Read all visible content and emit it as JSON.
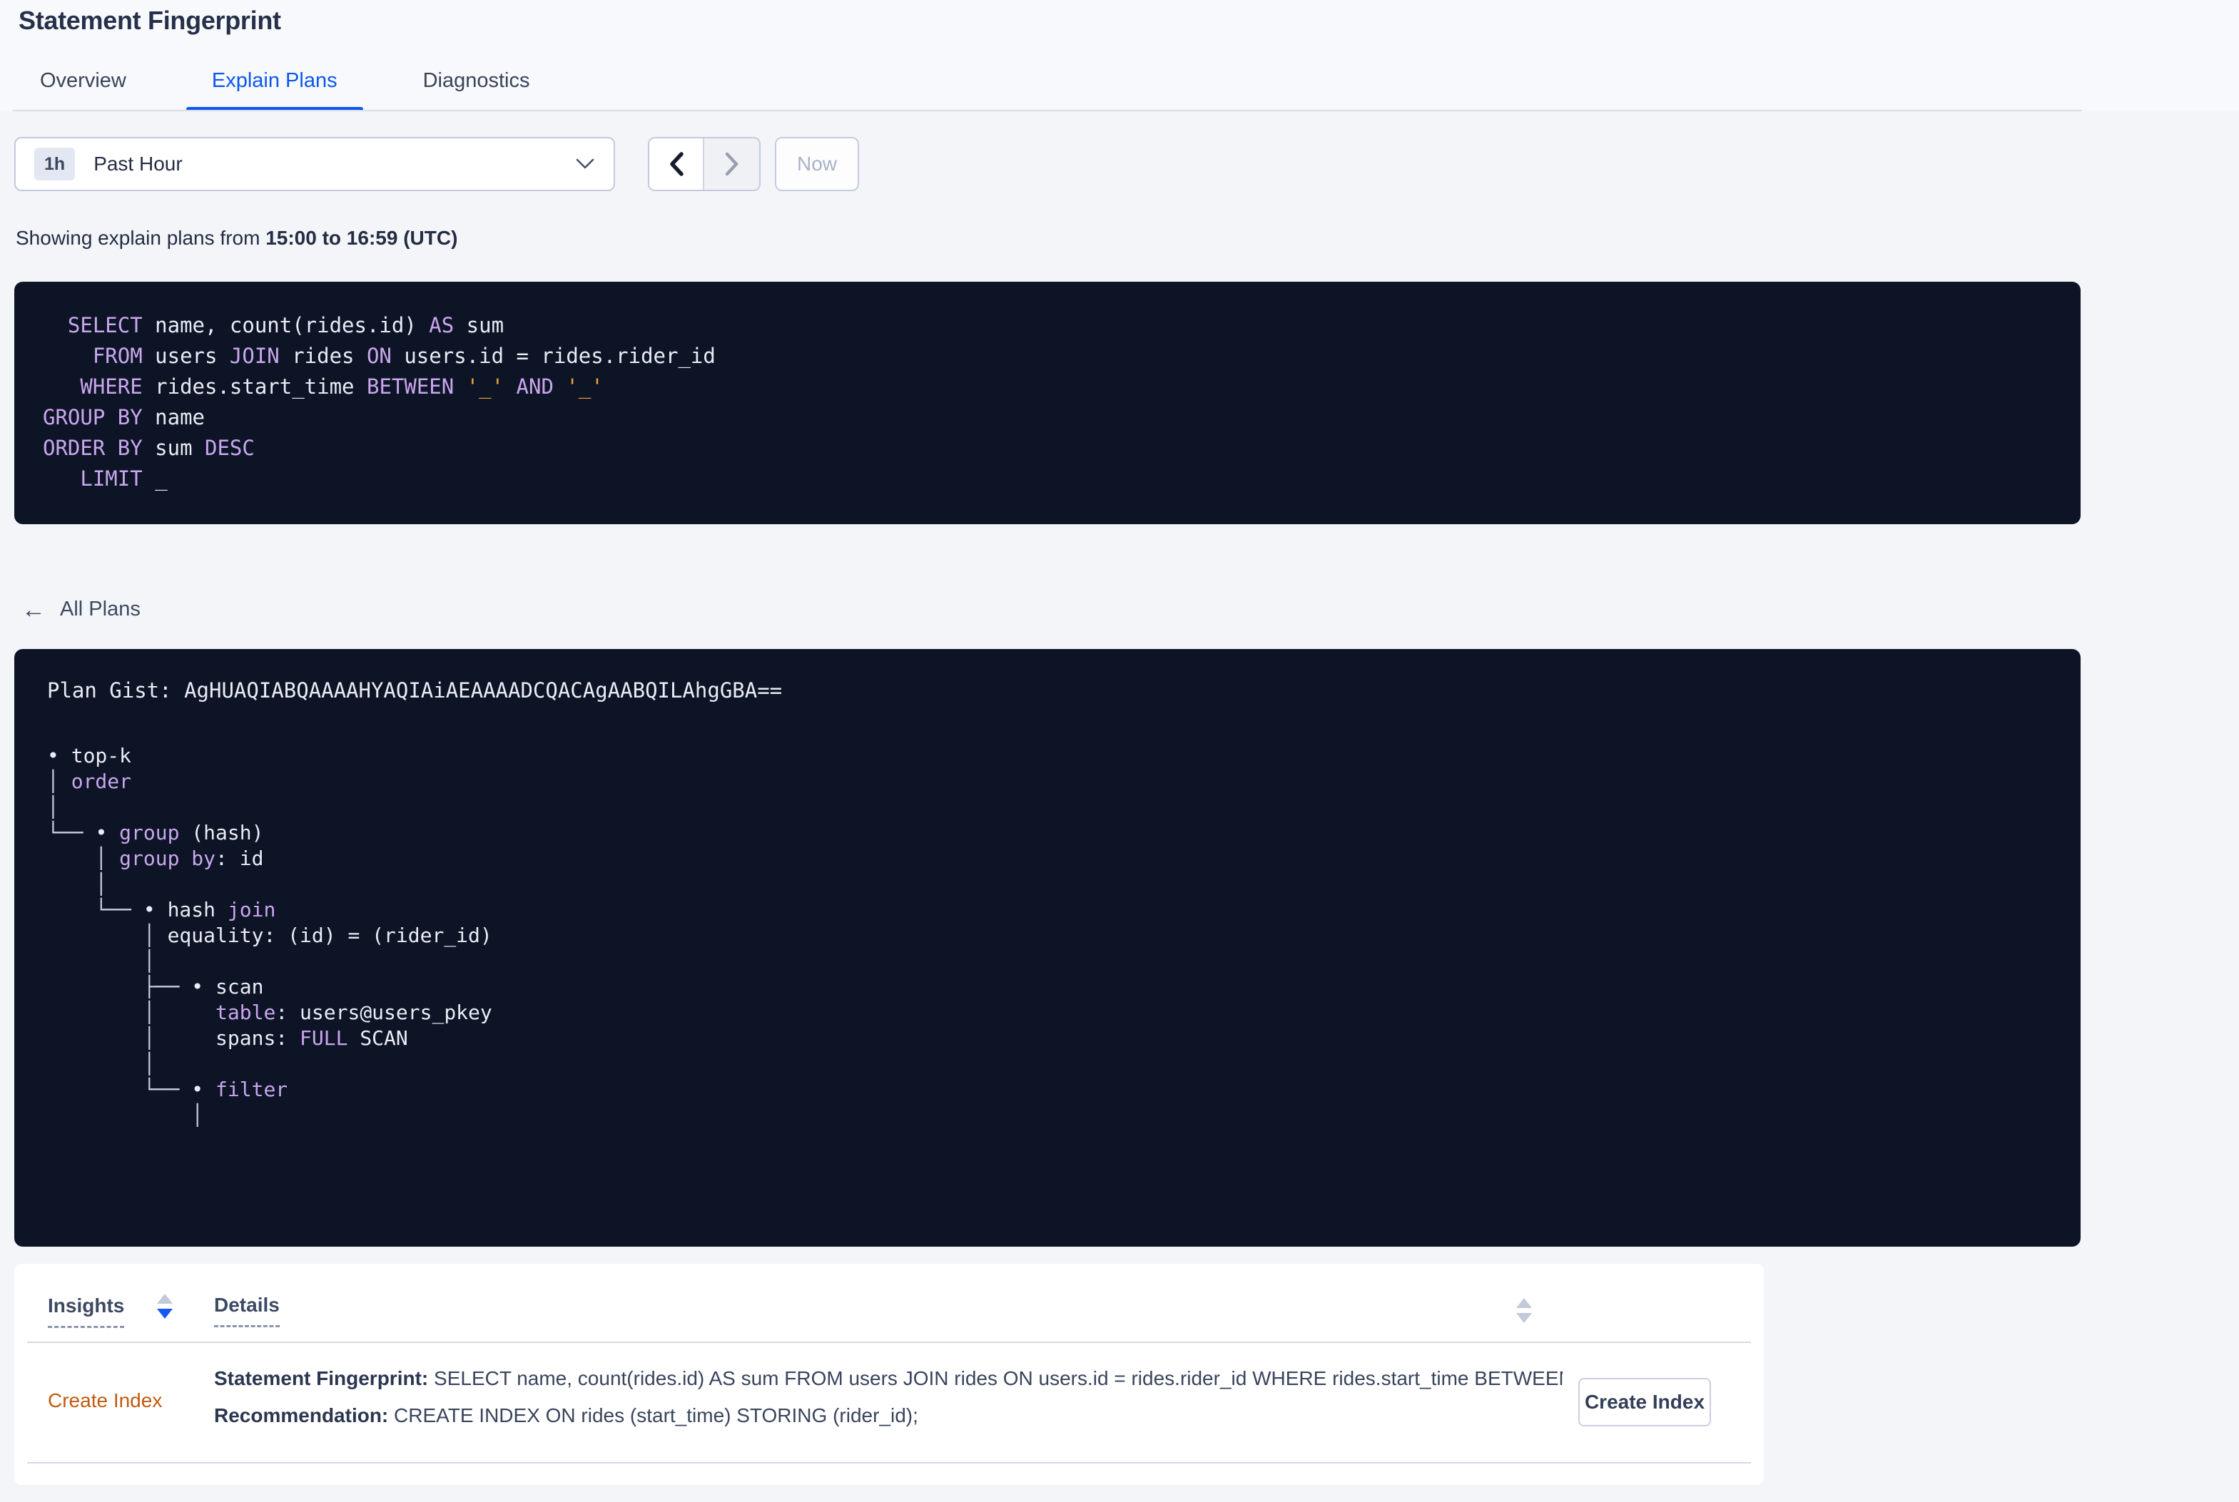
{
  "page": {
    "title": "Statement Fingerprint"
  },
  "tabs": [
    {
      "label": "Overview",
      "active": false
    },
    {
      "label": "Explain Plans",
      "active": true
    },
    {
      "label": "Diagnostics",
      "active": false
    }
  ],
  "time_picker": {
    "badge": "1h",
    "label": "Past Hour",
    "now_label": "Now"
  },
  "range_note": {
    "prefix": "Showing explain plans from ",
    "range": "15:00 to 16:59 (UTC)"
  },
  "sql": {
    "lines": [
      [
        [
          "id",
          "  "
        ],
        [
          "kw",
          "SELECT"
        ],
        [
          "id",
          " name, count(rides.id) "
        ],
        [
          "kw",
          "AS"
        ],
        [
          "id",
          " sum"
        ]
      ],
      [
        [
          "id",
          "    "
        ],
        [
          "kw",
          "FROM"
        ],
        [
          "id",
          " users "
        ],
        [
          "kw",
          "JOIN"
        ],
        [
          "id",
          " rides "
        ],
        [
          "kw",
          "ON"
        ],
        [
          "id",
          " users.id = rides.rider_id"
        ]
      ],
      [
        [
          "id",
          "   "
        ],
        [
          "kw",
          "WHERE"
        ],
        [
          "id",
          " rides.start_time "
        ],
        [
          "kw",
          "BETWEEN"
        ],
        [
          "id",
          " "
        ],
        [
          "lit",
          "'_'"
        ],
        [
          "id",
          " "
        ],
        [
          "kw",
          "AND"
        ],
        [
          "id",
          " "
        ],
        [
          "lit",
          "'_'"
        ]
      ],
      [
        [
          "kw",
          "GROUP BY"
        ],
        [
          "id",
          " name"
        ]
      ],
      [
        [
          "kw",
          "ORDER BY"
        ],
        [
          "id",
          " sum "
        ],
        [
          "kw",
          "DESC"
        ]
      ],
      [
        [
          "id",
          "   "
        ],
        [
          "kw",
          "LIMIT"
        ],
        [
          "id",
          " _"
        ]
      ]
    ]
  },
  "back_link": {
    "arrow": "←",
    "label": "All Plans"
  },
  "plan": {
    "gist_label": "Plan Gist: ",
    "gist": "AgHUAQIABQAAAAHYAQIAiAEAAAADCQACAgAABQILAhgGBA==",
    "tree_lines": [
      [
        [
          "id",
          "• top-k"
        ]
      ],
      [
        [
          "ln",
          "│ "
        ],
        [
          "kw",
          "order"
        ]
      ],
      [
        [
          "ln",
          "│"
        ]
      ],
      [
        [
          "ln",
          "└── "
        ],
        [
          "id",
          "• "
        ],
        [
          "kw",
          "group"
        ],
        [
          "id",
          " (hash)"
        ]
      ],
      [
        [
          "ln",
          "    │ "
        ],
        [
          "kw",
          "group by"
        ],
        [
          "id",
          ": id"
        ]
      ],
      [
        [
          "ln",
          "    │"
        ]
      ],
      [
        [
          "ln",
          "    └── "
        ],
        [
          "id",
          "• hash "
        ],
        [
          "kw",
          "join"
        ]
      ],
      [
        [
          "ln",
          "        │ "
        ],
        [
          "id",
          "equality: (id) = (rider_id)"
        ]
      ],
      [
        [
          "ln",
          "        │"
        ]
      ],
      [
        [
          "ln",
          "        ├── "
        ],
        [
          "id",
          "• scan"
        ]
      ],
      [
        [
          "ln",
          "        │     "
        ],
        [
          "kw",
          "table"
        ],
        [
          "id",
          ": users@users_pkey"
        ]
      ],
      [
        [
          "ln",
          "        │     "
        ],
        [
          "id",
          "spans: "
        ],
        [
          "kw",
          "FULL"
        ],
        [
          "id",
          " SCAN"
        ]
      ],
      [
        [
          "ln",
          "        │"
        ]
      ],
      [
        [
          "ln",
          "        └── "
        ],
        [
          "id",
          "• "
        ],
        [
          "kw",
          "filter"
        ]
      ],
      [
        [
          "ln",
          "            │"
        ]
      ]
    ]
  },
  "insights_table": {
    "columns": [
      {
        "label": "Insights"
      },
      {
        "label": "Details"
      }
    ],
    "row": {
      "insight": "Create Index",
      "statement_label": "Statement Fingerprint:",
      "statement": " SELECT name, count(rides.id) AS sum FROM users JOIN rides ON users.id = rides.rider_id WHERE rides.start_time BETWEEN '_…",
      "recommendation_label": "Recommendation:",
      "recommendation": " CREATE INDEX ON rides (start_time) STORING (rider_id);",
      "action_label": "Create Index"
    }
  },
  "colors": {
    "accent_blue": "#0b57f0",
    "sort_active_blue": "#1657f5",
    "insight_orange": "#c35a11",
    "code_background": "#0d1426",
    "code_keyword": "#c9a6ee",
    "code_identifier": "#e9ecf5",
    "code_literal": "#f3a43e",
    "page_background": "#f3f5f9"
  }
}
